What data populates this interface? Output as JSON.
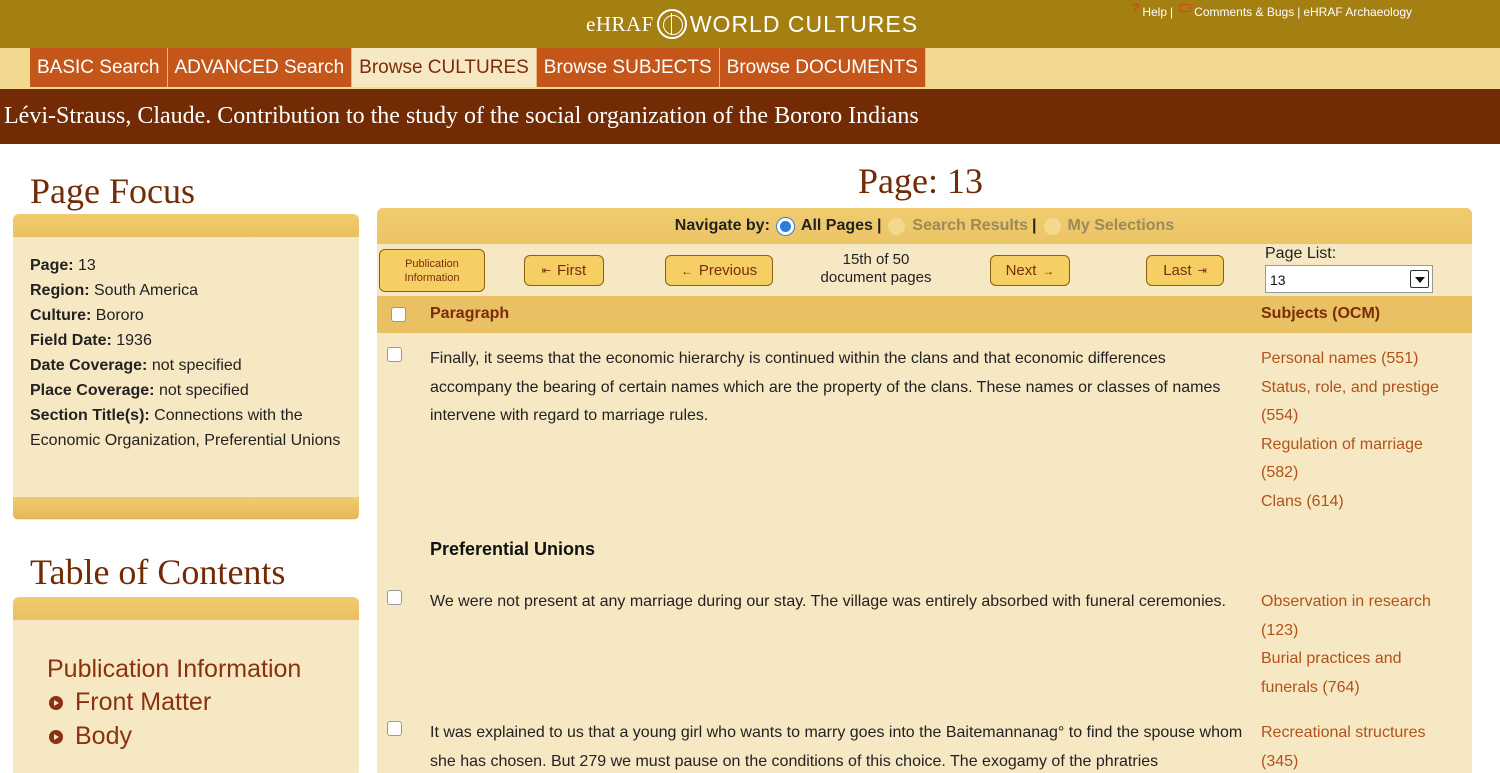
{
  "header": {
    "brand_left": "eHRAF",
    "brand_right": "WORLD CULTURES",
    "help_label": "Help",
    "separator": "|",
    "comments_label": "Comments & Bugs",
    "archaeology_label": "eHRAF Archaeology"
  },
  "nav": {
    "tabs": [
      {
        "label": "BASIC Search",
        "active": false
      },
      {
        "label": "ADVANCED Search",
        "active": false
      },
      {
        "label": "Browse CULTURES",
        "active": true
      },
      {
        "label": "Browse SUBJECTS",
        "active": false
      },
      {
        "label": "Browse DOCUMENTS",
        "active": false
      }
    ]
  },
  "document_title": "Lévi-Strauss, Claude. Contribution to the study of the social organization of the Bororo Indians",
  "page_focus": {
    "heading": "Page Focus",
    "page_label": "Page:",
    "page_value": "13",
    "region_label": "Region:",
    "region_value": "South America",
    "culture_label": "Culture:",
    "culture_value": "Bororo",
    "field_date_label": "Field Date:",
    "field_date_value": "1936",
    "date_coverage_label": "Date Coverage:",
    "date_coverage_value": "not specified",
    "place_coverage_label": "Place Coverage:",
    "place_coverage_value": "not specified",
    "section_title_label": "Section Title(s):",
    "section_title_value": "Connections with the Economic Organization, Preferential Unions"
  },
  "toc": {
    "heading": "Table of Contents",
    "publication_info": "Publication Information",
    "items": [
      "Front Matter",
      "Body"
    ]
  },
  "page_heading": "Page: 13",
  "navigate": {
    "label": "Navigate by:",
    "options": [
      {
        "label": "All Pages",
        "selected": true
      },
      {
        "label": "Search Results",
        "selected": false
      },
      {
        "label": "My Selections",
        "selected": false
      }
    ],
    "separator": "|"
  },
  "pager": {
    "pub_info_line1": "Publication",
    "pub_info_line2": "Information",
    "first_label": "First",
    "previous_label": "Previous",
    "count_line1": "15th of 50",
    "count_line2": "document pages",
    "next_label": "Next",
    "last_label": "Last",
    "page_list_label": "Page List:",
    "page_list_value": "13"
  },
  "table": {
    "col_paragraph": "Paragraph",
    "col_subjects": "Subjects (OCM)",
    "section_heading": "Preferential Unions",
    "rows": [
      {
        "text": "Finally, it seems that the economic hierarchy is continued within the clans and that economic differences accompany the bearing of certain names which are the property of the clans. These names or classes of names intervene with regard to marriage rules.",
        "subjects": [
          "Personal names (551)",
          "Status, role, and prestige (554)",
          "Regulation of marriage (582)",
          "Clans (614)"
        ]
      },
      {
        "text": "We were not present at any marriage during our stay. The village was entirely absorbed with funeral ceremonies.",
        "subjects": [
          "Observation in research (123)",
          "Burial practices and funerals (764)"
        ]
      },
      {
        "text": "It was explained to us that a young girl who wants to marry goes into the Baitemannanag° to find the spouse whom she has chosen. But 279 we must pause on the conditions of this choice. The exogamy of the phratries",
        "subjects": [
          "Recreational structures (345)"
        ]
      }
    ]
  }
}
